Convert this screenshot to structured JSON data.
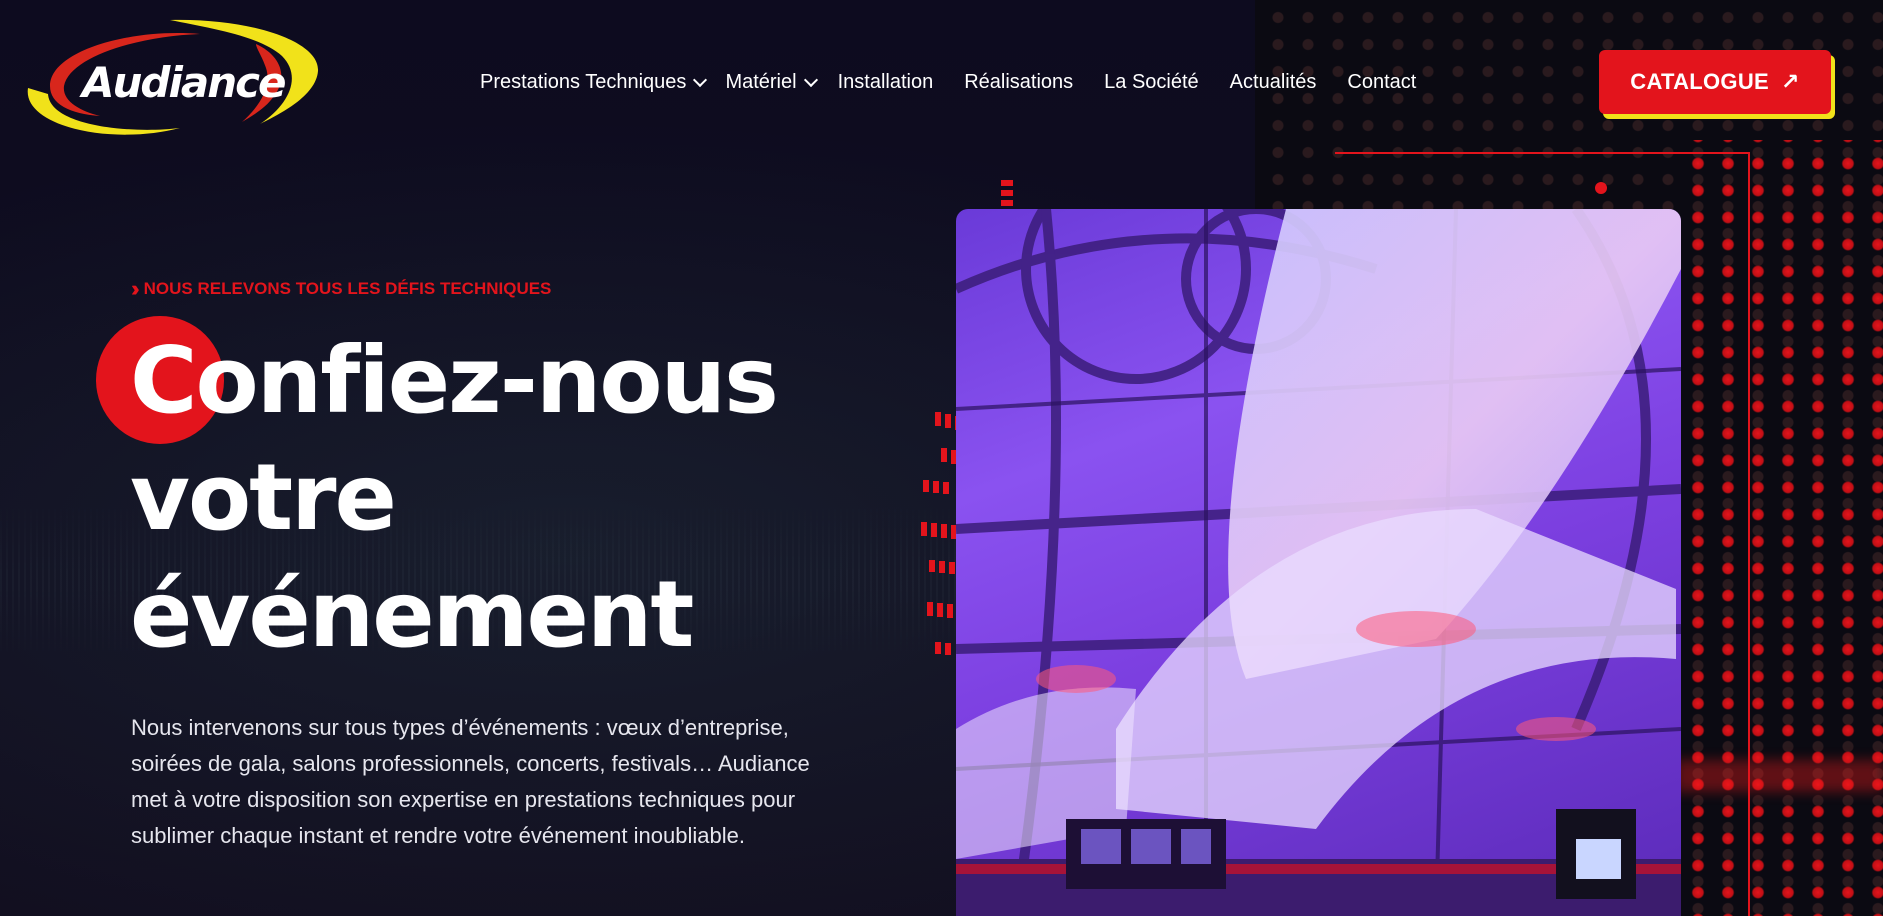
{
  "brand": {
    "logo_text": "Audiance",
    "colors": {
      "accent_red": "#e3141c",
      "accent_yellow": "#f1e21a",
      "background": "#0e0b1d"
    }
  },
  "nav": {
    "items": [
      {
        "label": "Prestations Techniques",
        "has_submenu": true
      },
      {
        "label": "Matériel",
        "has_submenu": true
      },
      {
        "label": "Installation",
        "has_submenu": false
      },
      {
        "label": "Réalisations",
        "has_submenu": false
      },
      {
        "label": "La Société",
        "has_submenu": false
      },
      {
        "label": "Actualités",
        "has_submenu": false
      },
      {
        "label": "Contact",
        "has_submenu": false
      }
    ],
    "cta_label": "CATALOGUE",
    "cta_icon": "arrow-up-right-icon"
  },
  "hero": {
    "eyebrow_icon": "double-chevron-right-icon",
    "eyebrow": "NOUS RELEVONS TOUS LES DÉFIS TECHNIQUES",
    "headline_lines": [
      "Confiez-nous",
      "votre",
      "événement"
    ],
    "description": "Nous intervenons sur tous types d’événements : vœux d’entreprise, soirées de gala, salons professionnels, concerts, festivals… Audiance met à votre disposition son expertise en prestations techniques pour sublimer chaque instant et rendre votre événement inoubliable."
  }
}
